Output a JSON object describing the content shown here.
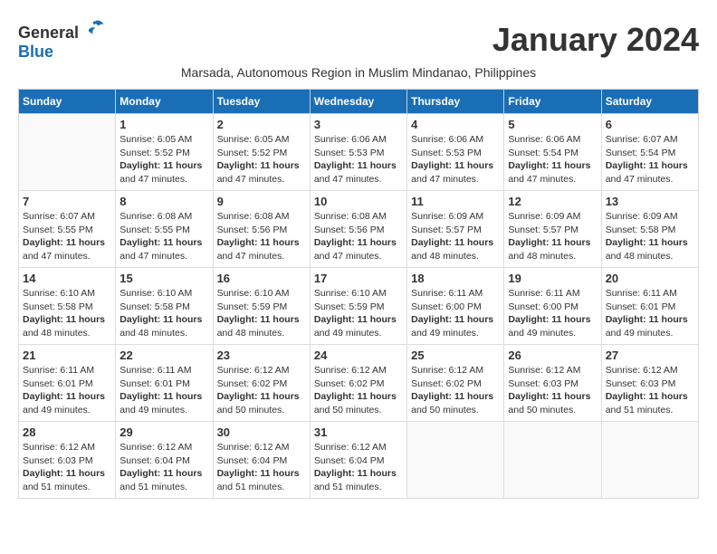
{
  "logo": {
    "general": "General",
    "blue": "Blue"
  },
  "title": "January 2024",
  "subtitle": "Marsada, Autonomous Region in Muslim Mindanao, Philippines",
  "days_header": [
    "Sunday",
    "Monday",
    "Tuesday",
    "Wednesday",
    "Thursday",
    "Friday",
    "Saturday"
  ],
  "weeks": [
    [
      {
        "day": "",
        "info": ""
      },
      {
        "day": "1",
        "info": "Sunrise: 6:05 AM\nSunset: 5:52 PM\nDaylight: 11 hours\nand 47 minutes."
      },
      {
        "day": "2",
        "info": "Sunrise: 6:05 AM\nSunset: 5:52 PM\nDaylight: 11 hours\nand 47 minutes."
      },
      {
        "day": "3",
        "info": "Sunrise: 6:06 AM\nSunset: 5:53 PM\nDaylight: 11 hours\nand 47 minutes."
      },
      {
        "day": "4",
        "info": "Sunrise: 6:06 AM\nSunset: 5:53 PM\nDaylight: 11 hours\nand 47 minutes."
      },
      {
        "day": "5",
        "info": "Sunrise: 6:06 AM\nSunset: 5:54 PM\nDaylight: 11 hours\nand 47 minutes."
      },
      {
        "day": "6",
        "info": "Sunrise: 6:07 AM\nSunset: 5:54 PM\nDaylight: 11 hours\nand 47 minutes."
      }
    ],
    [
      {
        "day": "7",
        "info": "Sunrise: 6:07 AM\nSunset: 5:55 PM\nDaylight: 11 hours\nand 47 minutes."
      },
      {
        "day": "8",
        "info": "Sunrise: 6:08 AM\nSunset: 5:55 PM\nDaylight: 11 hours\nand 47 minutes."
      },
      {
        "day": "9",
        "info": "Sunrise: 6:08 AM\nSunset: 5:56 PM\nDaylight: 11 hours\nand 47 minutes."
      },
      {
        "day": "10",
        "info": "Sunrise: 6:08 AM\nSunset: 5:56 PM\nDaylight: 11 hours\nand 47 minutes."
      },
      {
        "day": "11",
        "info": "Sunrise: 6:09 AM\nSunset: 5:57 PM\nDaylight: 11 hours\nand 48 minutes."
      },
      {
        "day": "12",
        "info": "Sunrise: 6:09 AM\nSunset: 5:57 PM\nDaylight: 11 hours\nand 48 minutes."
      },
      {
        "day": "13",
        "info": "Sunrise: 6:09 AM\nSunset: 5:58 PM\nDaylight: 11 hours\nand 48 minutes."
      }
    ],
    [
      {
        "day": "14",
        "info": "Sunrise: 6:10 AM\nSunset: 5:58 PM\nDaylight: 11 hours\nand 48 minutes."
      },
      {
        "day": "15",
        "info": "Sunrise: 6:10 AM\nSunset: 5:58 PM\nDaylight: 11 hours\nand 48 minutes."
      },
      {
        "day": "16",
        "info": "Sunrise: 6:10 AM\nSunset: 5:59 PM\nDaylight: 11 hours\nand 48 minutes."
      },
      {
        "day": "17",
        "info": "Sunrise: 6:10 AM\nSunset: 5:59 PM\nDaylight: 11 hours\nand 49 minutes."
      },
      {
        "day": "18",
        "info": "Sunrise: 6:11 AM\nSunset: 6:00 PM\nDaylight: 11 hours\nand 49 minutes."
      },
      {
        "day": "19",
        "info": "Sunrise: 6:11 AM\nSunset: 6:00 PM\nDaylight: 11 hours\nand 49 minutes."
      },
      {
        "day": "20",
        "info": "Sunrise: 6:11 AM\nSunset: 6:01 PM\nDaylight: 11 hours\nand 49 minutes."
      }
    ],
    [
      {
        "day": "21",
        "info": "Sunrise: 6:11 AM\nSunset: 6:01 PM\nDaylight: 11 hours\nand 49 minutes."
      },
      {
        "day": "22",
        "info": "Sunrise: 6:11 AM\nSunset: 6:01 PM\nDaylight: 11 hours\nand 49 minutes."
      },
      {
        "day": "23",
        "info": "Sunrise: 6:12 AM\nSunset: 6:02 PM\nDaylight: 11 hours\nand 50 minutes."
      },
      {
        "day": "24",
        "info": "Sunrise: 6:12 AM\nSunset: 6:02 PM\nDaylight: 11 hours\nand 50 minutes."
      },
      {
        "day": "25",
        "info": "Sunrise: 6:12 AM\nSunset: 6:02 PM\nDaylight: 11 hours\nand 50 minutes."
      },
      {
        "day": "26",
        "info": "Sunrise: 6:12 AM\nSunset: 6:03 PM\nDaylight: 11 hours\nand 50 minutes."
      },
      {
        "day": "27",
        "info": "Sunrise: 6:12 AM\nSunset: 6:03 PM\nDaylight: 11 hours\nand 51 minutes."
      }
    ],
    [
      {
        "day": "28",
        "info": "Sunrise: 6:12 AM\nSunset: 6:03 PM\nDaylight: 11 hours\nand 51 minutes."
      },
      {
        "day": "29",
        "info": "Sunrise: 6:12 AM\nSunset: 6:04 PM\nDaylight: 11 hours\nand 51 minutes."
      },
      {
        "day": "30",
        "info": "Sunrise: 6:12 AM\nSunset: 6:04 PM\nDaylight: 11 hours\nand 51 minutes."
      },
      {
        "day": "31",
        "info": "Sunrise: 6:12 AM\nSunset: 6:04 PM\nDaylight: 11 hours\nand 51 minutes."
      },
      {
        "day": "",
        "info": ""
      },
      {
        "day": "",
        "info": ""
      },
      {
        "day": "",
        "info": ""
      }
    ]
  ]
}
